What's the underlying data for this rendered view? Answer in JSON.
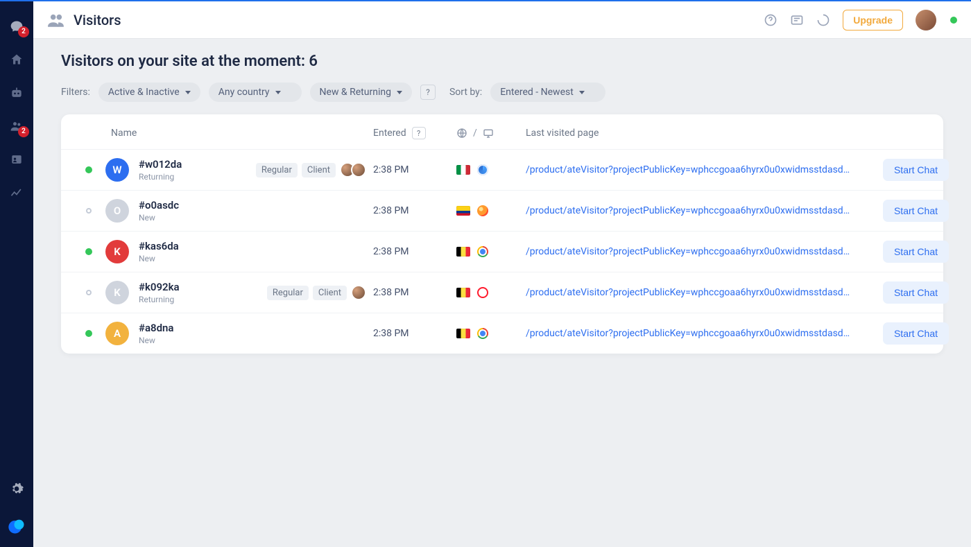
{
  "nav": {
    "badges": {
      "chat": "2",
      "people": "2"
    }
  },
  "header": {
    "title": "Visitors",
    "upgrade_label": "Upgrade"
  },
  "page": {
    "heading_prefix": "Visitors on your site at the moment: ",
    "count": "6"
  },
  "filters": {
    "label": "Filters:",
    "activity": "Active & Inactive",
    "country": "Any country",
    "type": "New & Returning",
    "sort_label": "Sort by:",
    "sort_value": "Entered - Newest"
  },
  "columns": {
    "name": "Name",
    "entered": "Entered",
    "last_page": "Last visited page"
  },
  "rows": [
    {
      "status": "active",
      "initial": "W",
      "avatar_bg": "#2d6ef0",
      "id": "#w012da",
      "sub": "Returning",
      "tags": [
        "Regular",
        "Client"
      ],
      "operators": 2,
      "time": "2:38 PM",
      "flag": "it",
      "browser": "safari",
      "url": "/product/ateVisitor?projectPublicKey=wphccgoaa6hyrx0u0xwidmsstdasdml…",
      "action": "Start Chat"
    },
    {
      "status": "idle",
      "initial": "O",
      "avatar_bg": "#cfd4dd",
      "id": "#o0asdc",
      "sub": "New",
      "tags": [],
      "operators": 0,
      "time": "2:38 PM",
      "flag": "co",
      "browser": "firefox",
      "url": "/product/ateVisitor?projectPublicKey=wphccgoaa6hyrx0u0xwidmsstdasdmk…",
      "action": "Start Chat"
    },
    {
      "status": "active",
      "initial": "K",
      "avatar_bg": "#e23b3b",
      "id": "#kas6da",
      "sub": "New",
      "tags": [],
      "operators": 0,
      "time": "2:38 PM",
      "flag": "be",
      "browser": "chrome",
      "url": "/product/ateVisitor?projectPublicKey=wphccgoaa6hyrx0u0xwidmsstdasdmk…",
      "action": "Start Chat"
    },
    {
      "status": "idle",
      "initial": "K",
      "avatar_bg": "#cfd4dd",
      "id": "#k092ka",
      "sub": "Returning",
      "tags": [
        "Regular",
        "Client"
      ],
      "operators": 1,
      "time": "2:38 PM",
      "flag": "be",
      "browser": "opera",
      "url": "/product/ateVisitor?projectPublicKey=wphccgoaa6hyrx0u0xwidmsstdasdmk…",
      "action": "Start Chat"
    },
    {
      "status": "active",
      "initial": "A",
      "avatar_bg": "#f2b23e",
      "id": "#a8dna",
      "sub": "New",
      "tags": [],
      "operators": 0,
      "time": "2:38 PM",
      "flag": "be",
      "browser": "chrome",
      "url": "/product/ateVisitor?projectPublicKey=wphccgoaa6hyrx0u0xwidmsstdasdmk…",
      "action": "Start Chat"
    }
  ]
}
